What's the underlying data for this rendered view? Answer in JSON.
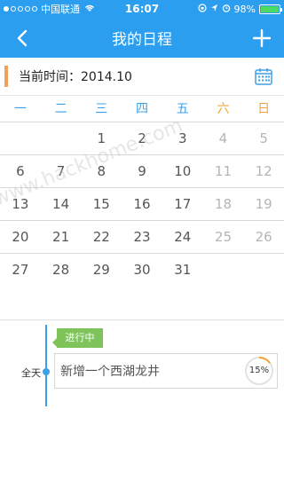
{
  "status_bar": {
    "carrier": "中国联通",
    "time": "16:07",
    "battery": "98%",
    "battery_level": 0.98,
    "signal_dots": [
      true,
      false,
      false,
      false,
      false
    ]
  },
  "nav": {
    "title": "我的日程",
    "back_icon": "chevron-left-icon",
    "add_icon": "plus-icon"
  },
  "current": {
    "label": "当前时间：2014.10",
    "accent_color": "#f0a25a"
  },
  "calendar": {
    "weekdays": [
      "一",
      "二",
      "三",
      "四",
      "五",
      "六",
      "日"
    ],
    "weeks": [
      [
        "",
        "",
        "1",
        "2",
        "3",
        "4",
        "5"
      ],
      [
        "6",
        "7",
        "8",
        "9",
        "10",
        "11",
        "12"
      ],
      [
        "13",
        "14",
        "15",
        "16",
        "17",
        "18",
        "19"
      ],
      [
        "20",
        "21",
        "22",
        "23",
        "24",
        "25",
        "26"
      ],
      [
        "27",
        "28",
        "29",
        "30",
        "31",
        "",
        ""
      ]
    ]
  },
  "schedule": {
    "all_day_label": "全天",
    "status": "进行中",
    "event_title": "新增一个西湖龙井",
    "progress": 15,
    "progress_label": "15%",
    "status_color": "#7ec45b",
    "accent_color": "#3ba0e6"
  },
  "watermark": "www.hackhome.com"
}
